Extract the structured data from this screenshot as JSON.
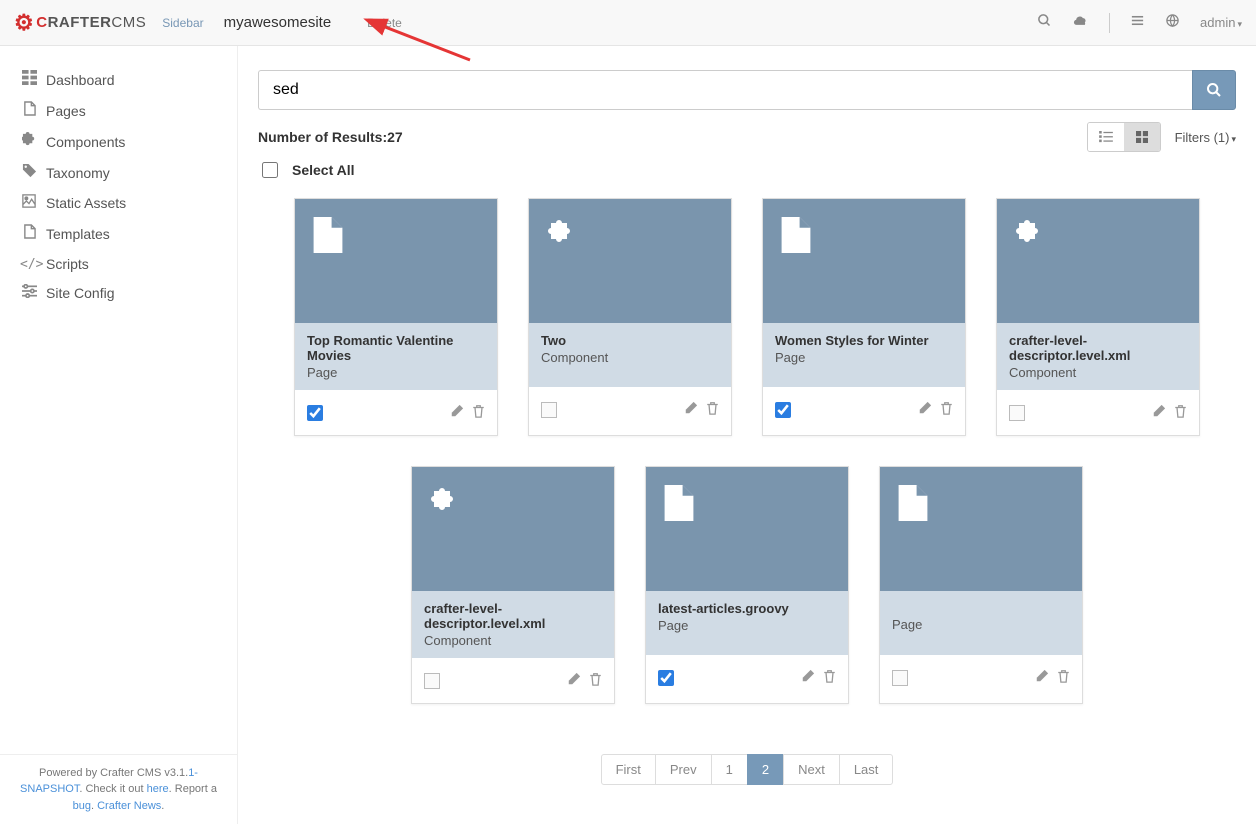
{
  "topbar": {
    "logo_text": "CRAFTERCMS",
    "sidebar_toggle": "Sidebar",
    "site_name": "myawesomesite",
    "delete": "Delete",
    "admin": "admin"
  },
  "sidebar": {
    "items": [
      {
        "icon": "dashboard",
        "label": "Dashboard"
      },
      {
        "icon": "file",
        "label": "Pages"
      },
      {
        "icon": "puzzle",
        "label": "Components"
      },
      {
        "icon": "tag",
        "label": "Taxonomy"
      },
      {
        "icon": "image",
        "label": "Static Assets"
      },
      {
        "icon": "file",
        "label": "Templates"
      },
      {
        "icon": "code",
        "label": "Scripts"
      },
      {
        "icon": "sliders",
        "label": "Site Config"
      }
    ],
    "footer": {
      "text1": "Powered by Crafter CMS v3.1.",
      "version_link": "1-SNAPSHOT",
      "text2": ". Check it out ",
      "here": "here",
      "text3": ". Report a ",
      "bug": "bug",
      "text4": ". ",
      "news": "Crafter News",
      "text5": "."
    }
  },
  "search": {
    "value": "sed",
    "placeholder": ""
  },
  "results": {
    "label": "Number of Results: ",
    "count": "27",
    "filters_label": "Filters (1)",
    "select_all": "Select All"
  },
  "cards": [
    {
      "kind": "page",
      "title": "Top Romantic Valentine Movies",
      "type": "Page",
      "checked": true
    },
    {
      "kind": "component",
      "title": "Two",
      "type": "Component",
      "checked": false
    },
    {
      "kind": "page",
      "title": "Women Styles for Winter",
      "type": "Page",
      "checked": true
    },
    {
      "kind": "component",
      "title": "crafter-level-descriptor.level.xml",
      "type": "Component",
      "checked": false
    },
    {
      "kind": "component",
      "title": "crafter-level-descriptor.level.xml",
      "type": "Component",
      "checked": false
    },
    {
      "kind": "page",
      "title": "latest-articles.groovy",
      "type": "Page",
      "checked": true
    },
    {
      "kind": "page",
      "title": "",
      "type": "Page",
      "checked": false
    }
  ],
  "pagination": {
    "first": "First",
    "prev": "Prev",
    "pages": [
      "1",
      "2"
    ],
    "active": "2",
    "next": "Next",
    "last": "Last"
  }
}
